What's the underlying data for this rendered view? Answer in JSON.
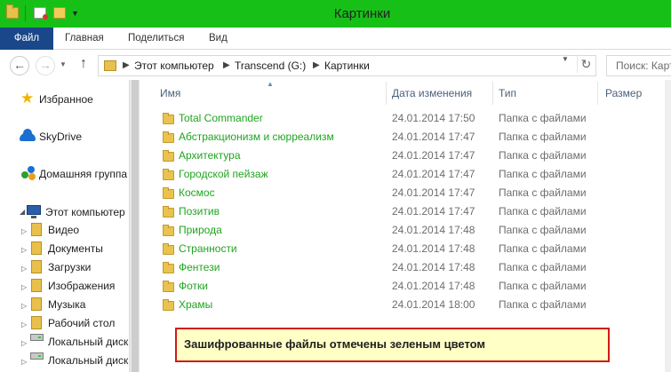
{
  "window": {
    "title": "Картинки",
    "accent_color": "#17c017"
  },
  "ribbon": {
    "tabs": [
      {
        "label": "Файл",
        "active": true
      },
      {
        "label": "Главная"
      },
      {
        "label": "Поделиться"
      },
      {
        "label": "Вид"
      }
    ]
  },
  "address": {
    "crumbs": [
      "Этот компьютер",
      "Transcend (G:)",
      "Картинки"
    ],
    "search_placeholder": "Поиск: Карт"
  },
  "nav_pane": {
    "favorites": "Избранное",
    "skydrive": "SkyDrive",
    "homegroup": "Домашняя группа",
    "computer": "Этот компьютер",
    "children": [
      "Видео",
      "Документы",
      "Загрузки",
      "Изображения",
      "Музыка",
      "Рабочий стол",
      "Локальный диск",
      "Локальный диск"
    ]
  },
  "file_list": {
    "columns": {
      "name": "Имя",
      "date": "Дата изменения",
      "type": "Тип",
      "size": "Размер"
    },
    "encrypted_color": "#1fa51f",
    "rows": [
      {
        "name": "Total Commander",
        "date": "24.01.2014 17:50",
        "type": "Папка с файлами"
      },
      {
        "name": "Абстракционизм и сюрреализм",
        "date": "24.01.2014 17:47",
        "type": "Папка с файлами"
      },
      {
        "name": "Архитектура",
        "date": "24.01.2014 17:47",
        "type": "Папка с файлами"
      },
      {
        "name": "Городской пейзаж",
        "date": "24.01.2014 17:47",
        "type": "Папка с файлами"
      },
      {
        "name": "Космос",
        "date": "24.01.2014 17:47",
        "type": "Папка с файлами"
      },
      {
        "name": "Позитив",
        "date": "24.01.2014 17:47",
        "type": "Папка с файлами"
      },
      {
        "name": "Природа",
        "date": "24.01.2014 17:48",
        "type": "Папка с файлами"
      },
      {
        "name": "Странности",
        "date": "24.01.2014 17:48",
        "type": "Папка с файлами"
      },
      {
        "name": "Фентези",
        "date": "24.01.2014 17:48",
        "type": "Папка с файлами"
      },
      {
        "name": "Фотки",
        "date": "24.01.2014 17:48",
        "type": "Папка с файлами"
      },
      {
        "name": "Храмы",
        "date": "24.01.2014 18:00",
        "type": "Папка с файлами"
      }
    ]
  },
  "annotation": {
    "text": "Зашифрованные файлы отмечены зеленым цветом"
  }
}
